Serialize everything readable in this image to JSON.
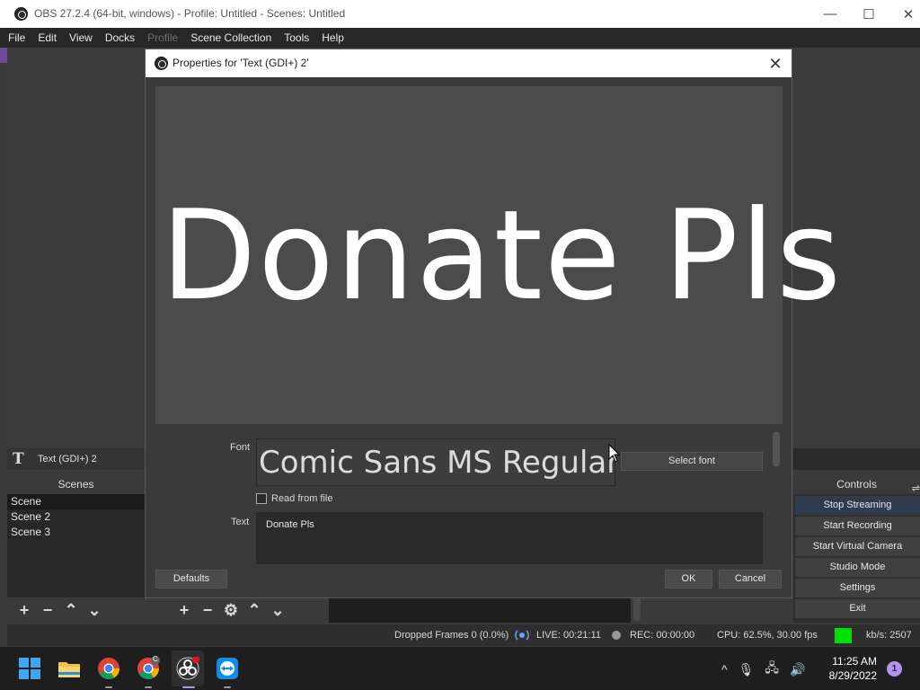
{
  "window": {
    "title": "OBS 27.2.4 (64-bit, windows) - Profile: Untitled - Scenes: Untitled",
    "minimize": "—",
    "maximize": "☐",
    "close": "✕"
  },
  "menu": [
    "File",
    "Edit",
    "View",
    "Docks",
    "Profile",
    "Scene Collection",
    "Tools",
    "Help"
  ],
  "sources": {
    "icon_glyph": "T",
    "selected": "Text (GDI+) 2"
  },
  "scenes": {
    "header": "Scenes",
    "items": [
      "Scene",
      "Scene 2",
      "Scene 3"
    ]
  },
  "toolbar_glyphs": {
    "add": "+",
    "remove": "−",
    "up": "⌃",
    "down": "⌄",
    "gear": "⚙"
  },
  "controls": {
    "header": "Controls",
    "menu_glyph": "⇌",
    "buttons": [
      "Stop Streaming",
      "Start Recording",
      "Start Virtual Camera",
      "Studio Mode",
      "Settings",
      "Exit"
    ]
  },
  "status": {
    "dropped_frames": "Dropped Frames 0 (0.0%)",
    "live": "LIVE: 00:21:11",
    "rec": "REC: 00:00:00",
    "cpu": "CPU: 62.5%, 30.00 fps",
    "kbps": "kb/s: 2507",
    "kbps_indicator_color": "#00e000"
  },
  "dialog": {
    "title": "Properties for 'Text (GDI+) 2'",
    "close": "✕",
    "preview_text": "Donate Pls",
    "font_label": "Font",
    "font_value": "Comic Sans MS Regular",
    "select_font": "Select font",
    "read_from_file": "Read from file",
    "text_label": "Text",
    "text_value": "Donate Pls",
    "defaults": "Defaults",
    "ok": "OK",
    "cancel": "Cancel"
  },
  "taskbar": {
    "apps": [
      "windows-start-icon",
      "file-explorer-icon",
      "chrome-icon",
      "chrome-profile-icon",
      "obs-icon",
      "teamviewer-icon"
    ],
    "chrome_profile_badge": "C",
    "tray": {
      "chevron": "^",
      "mic": "🎙",
      "network": "🖧",
      "volume": "🔊"
    },
    "time": "11:25 AM",
    "date": "8/29/2022",
    "notifications": "1"
  }
}
